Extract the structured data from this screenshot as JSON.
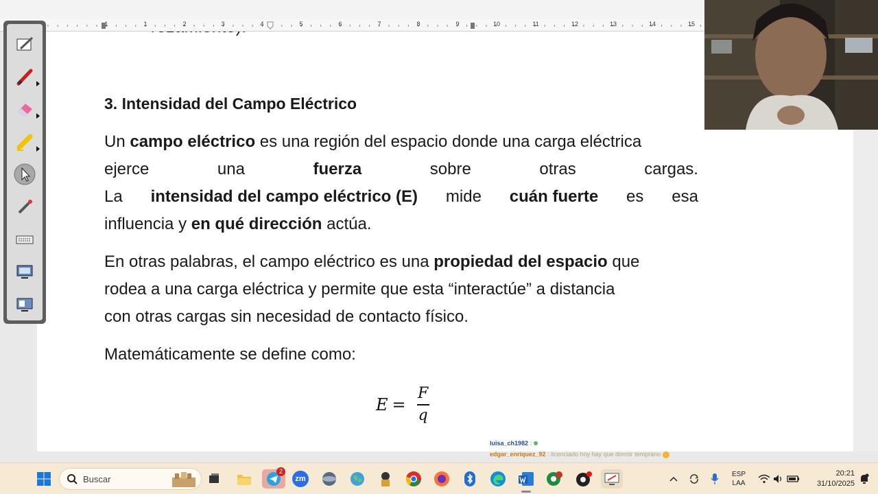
{
  "ruler": {
    "numbers": [
      "1",
      "1",
      "2",
      "3",
      "4",
      "5",
      "6",
      "7",
      "8",
      "9",
      "10",
      "11",
      "12",
      "13",
      "14",
      "15"
    ]
  },
  "document": {
    "cut_line": "rozamiento).",
    "heading": "3. Intensidad del Campo Eléctrico",
    "p1": {
      "l1_a": "Un ",
      "l1_b": "campo eléctrico",
      "l1_c": " es una región del espacio donde una carga eléctrica",
      "l2": [
        "ejerce",
        "una",
        "fuerza",
        "sobre",
        "otras",
        "cargas."
      ],
      "l3": [
        "La",
        "intensidad del campo eléctrico (E)",
        "mide",
        "cuán fuerte",
        "es",
        "esa"
      ],
      "l4_a": "influencia y ",
      "l4_b": "en qué dirección",
      "l4_c": " actúa."
    },
    "p2": {
      "l1_a": "En otras palabras, el campo eléctrico es una ",
      "l1_b": "propiedad del espacio",
      "l1_c": " que",
      "l2": "rodea a una carga eléctrica y permite que esta “interactúe” a distancia",
      "l3": "con otras cargas sin necesidad de contacto físico."
    },
    "p3": "Matemáticamente se define como:",
    "formula": {
      "lhs": "E",
      "op": "=",
      "numerator": "F",
      "denominator": "q"
    }
  },
  "chat": {
    "user1": "luisa_ch1982",
    "user1_sep": ":",
    "user2": "edgar_enriquez_92",
    "user2_msg": ": licenciado hoy hay que dormir temprano"
  },
  "taskbar": {
    "search_placeholder": "Buscar",
    "telegram_badge": "2",
    "zoom_label": "zm",
    "lang_top": "ESP",
    "lang_bottom": "LAA",
    "time": "20:21",
    "date": "31/10/2025"
  },
  "colors": {
    "taskbar_bg": "#f7ead4",
    "toolbar_frame": "#5d5d5d",
    "chat_user1": "#1f4f99",
    "chat_user2": "#c47a18"
  }
}
